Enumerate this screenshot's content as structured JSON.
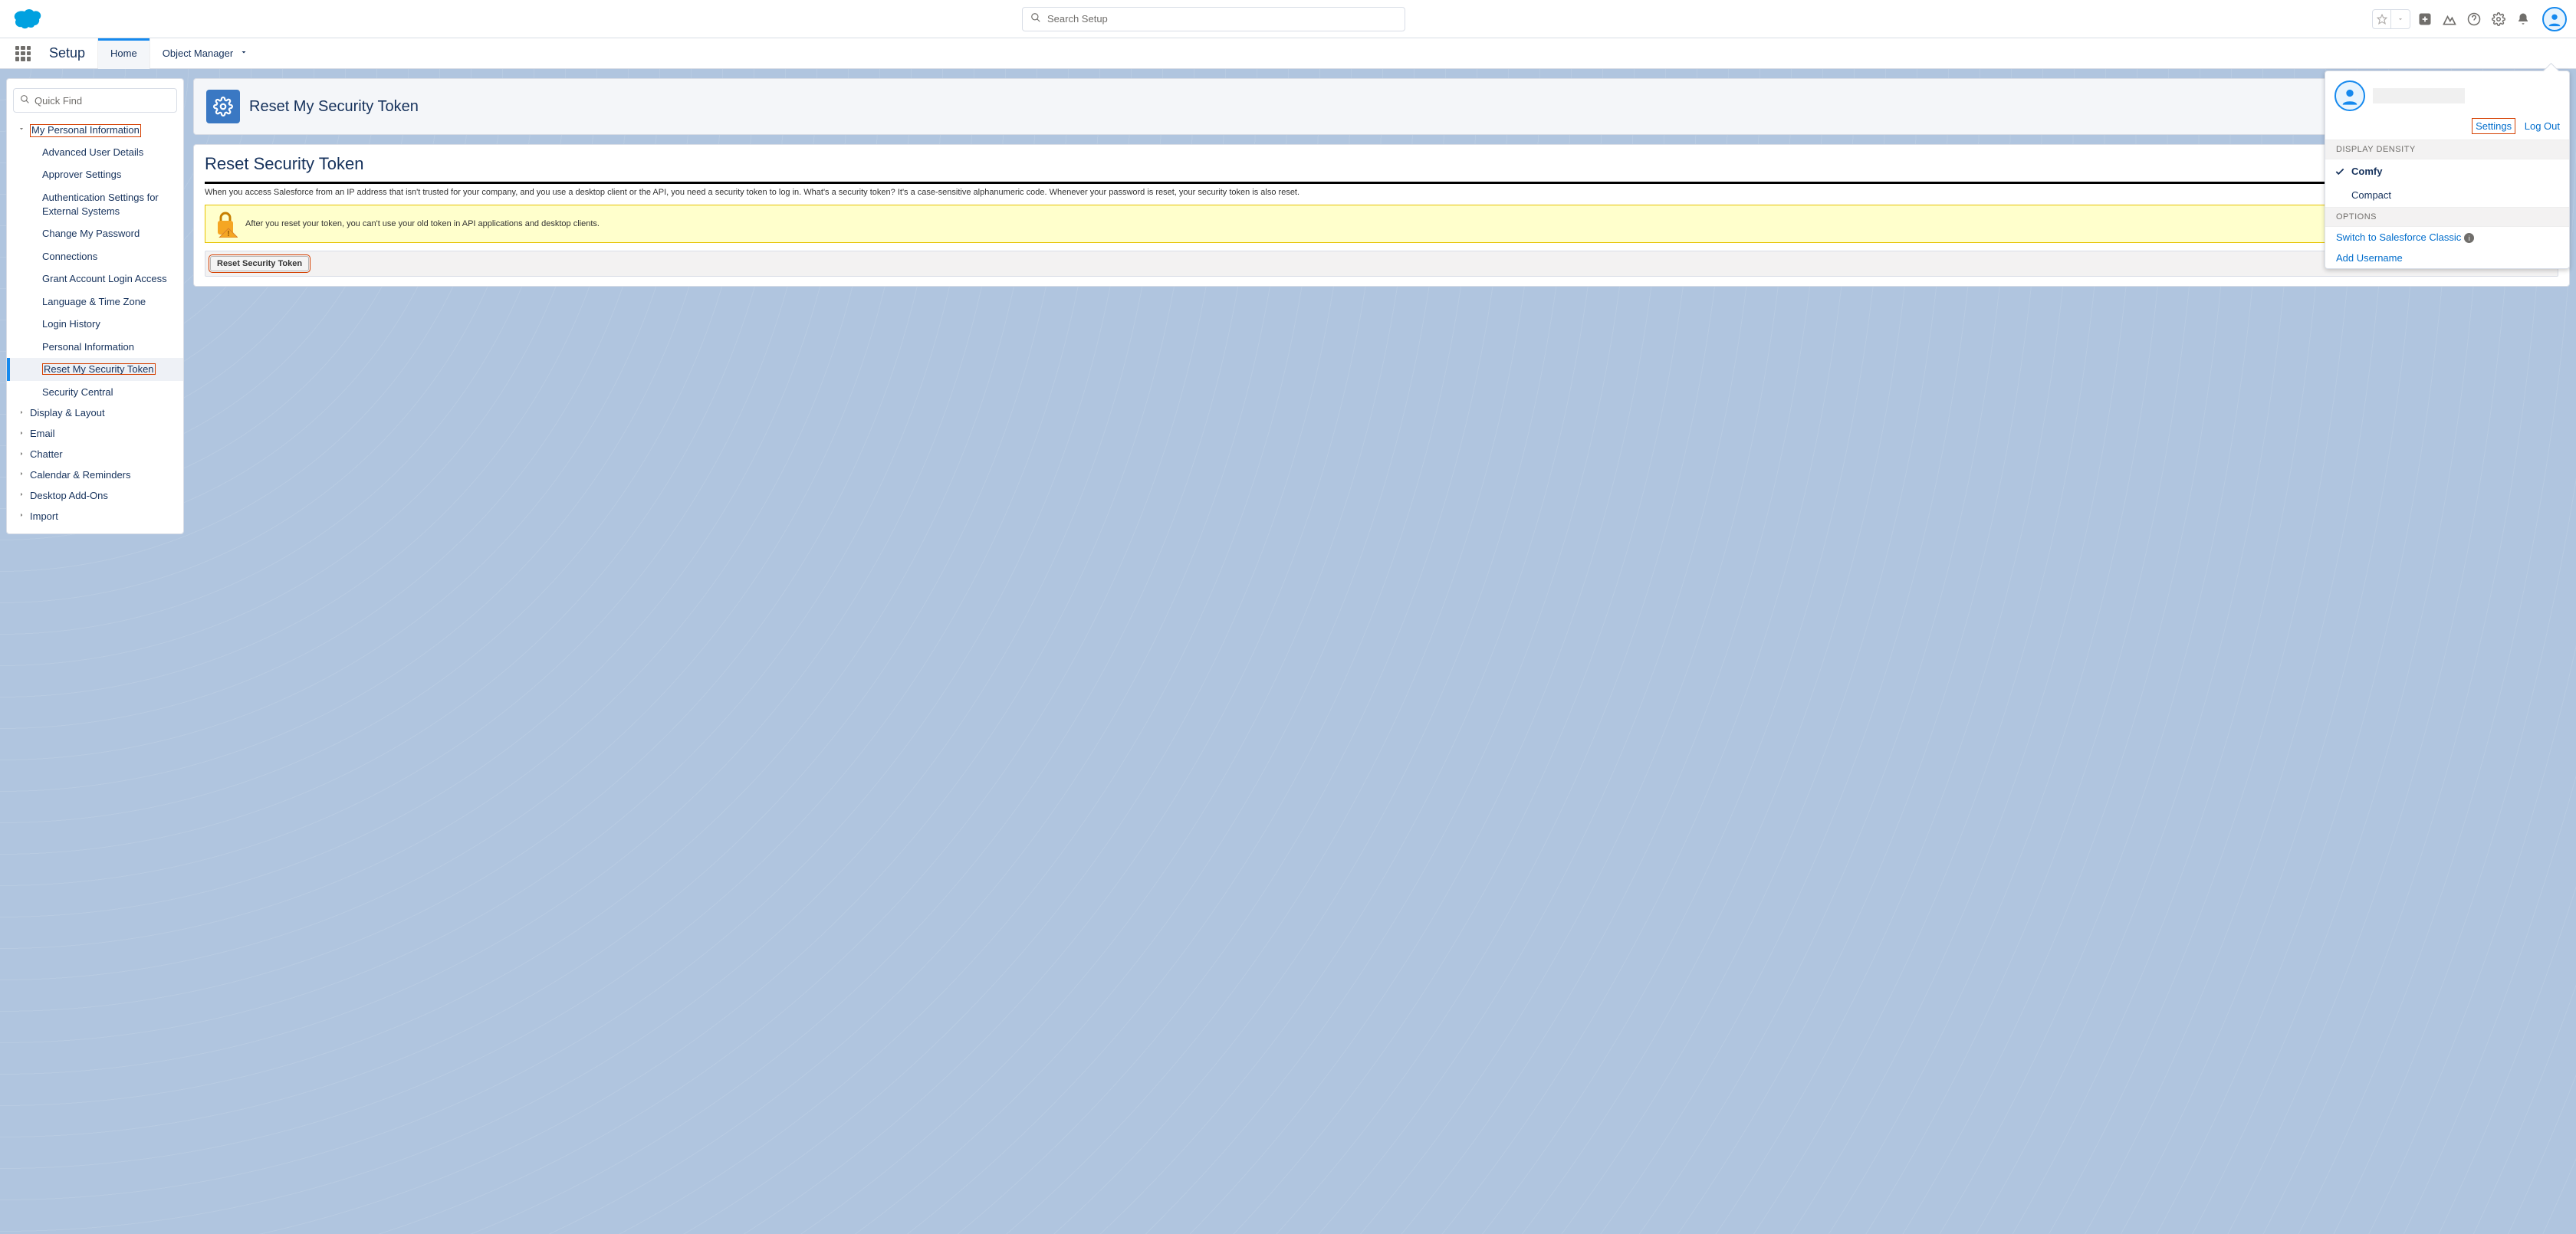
{
  "header": {
    "search_placeholder": "Search Setup",
    "icons": [
      "favorites",
      "favorites-dropdown",
      "add",
      "trailhead",
      "help",
      "setup",
      "notifications",
      "avatar"
    ]
  },
  "context_bar": {
    "app_name": "Setup",
    "tabs": [
      {
        "label": "Home",
        "active": true
      },
      {
        "label": "Object Manager",
        "active": false,
        "has_menu": true
      }
    ]
  },
  "sidebar": {
    "quick_find_placeholder": "Quick Find",
    "section": {
      "label": "My Personal Information",
      "open": true,
      "highlighted": true,
      "items": [
        "Advanced User Details",
        "Approver Settings",
        "Authentication Settings for External Systems",
        "Change My Password",
        "Connections",
        "Grant Account Login Access",
        "Language & Time Zone",
        "Login History",
        "Personal Information",
        "Reset My Security Token",
        "Security Central"
      ],
      "selected_index": 9,
      "highlighted_index": 9
    },
    "collapsed_sections": [
      "Display & Layout",
      "Email",
      "Chatter",
      "Calendar & Reminders",
      "Desktop Add-Ons",
      "Import"
    ]
  },
  "page": {
    "header_title": "Reset My Security Token",
    "card_title": "Reset Security Token",
    "info_text": "When you access Salesforce from an IP address that isn't trusted for your company, and you use a desktop client or the API, you need a security token to log in. What's a security token? It's a case-sensitive alphanumeric code. Whenever your password is reset, your security token is also reset.",
    "warn_text": "After you reset your token, you can't use your old token in API applications and desktop clients.",
    "button_label": "Reset Security Token"
  },
  "popover": {
    "settings_label": "Settings",
    "logout_label": "Log Out",
    "density_header": "DISPLAY DENSITY",
    "density_options": [
      {
        "label": "Comfy",
        "selected": true
      },
      {
        "label": "Compact",
        "selected": false
      }
    ],
    "options_header": "OPTIONS",
    "options": [
      {
        "label": "Switch to Salesforce Classic",
        "info": true
      },
      {
        "label": "Add Username",
        "info": false
      }
    ]
  }
}
